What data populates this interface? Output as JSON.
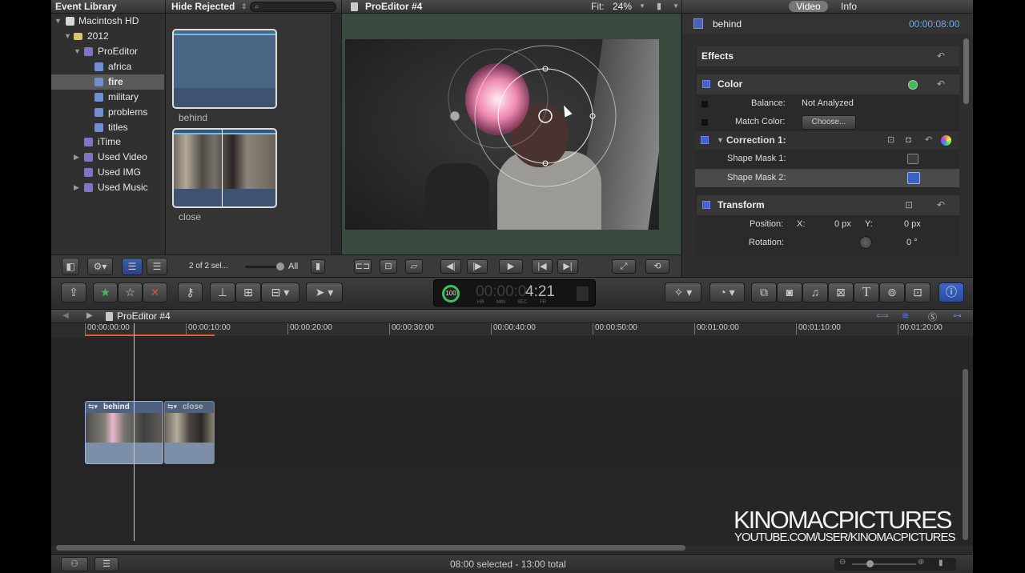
{
  "event_library": {
    "title": "Event Library",
    "items": [
      {
        "label": "Macintosh HD",
        "icon": "hard-drive-icon"
      },
      {
        "label": "2012",
        "icon": "folder-icon"
      },
      {
        "label": "ProEditor",
        "icon": "event-star-icon"
      },
      {
        "label": "africa",
        "icon": "keyword-icon"
      },
      {
        "label": "fire",
        "icon": "keyword-icon"
      },
      {
        "label": "military",
        "icon": "keyword-icon"
      },
      {
        "label": "problems",
        "icon": "keyword-icon"
      },
      {
        "label": "titles",
        "icon": "keyword-icon"
      },
      {
        "label": "iTime",
        "icon": "event-star-icon"
      },
      {
        "label": "Used Video",
        "icon": "event-star-icon"
      },
      {
        "label": "Used IMG",
        "icon": "event-star-icon"
      },
      {
        "label": "Used Music",
        "icon": "event-star-icon"
      }
    ]
  },
  "browser": {
    "filter_label": "Hide Rejected",
    "search_placeholder": "",
    "clips": [
      {
        "label": "behind"
      },
      {
        "label": "close"
      }
    ],
    "selection_info": "2 of 2 sel...",
    "duration_all": "All"
  },
  "viewer": {
    "title": "ProEditor #4",
    "fit_label": "Fit:",
    "zoom": "24%"
  },
  "inspector": {
    "tabs": [
      "Video",
      "Info"
    ],
    "active_tab": "Video",
    "clip_name": "behind",
    "clip_duration": "00:00:08:00",
    "effects_label": "Effects",
    "color_label": "Color",
    "balance_label": "Balance:",
    "balance_value": "Not Analyzed",
    "match_color_label": "Match Color:",
    "choose_label": "Choose...",
    "correction_label": "Correction 1:",
    "shape_mask_1": "Shape Mask 1:",
    "shape_mask_2": "Shape Mask 2:",
    "transform_label": "Transform",
    "position_label": "Position:",
    "x_label": "X:",
    "x_value": "0 px",
    "y_label": "Y:",
    "y_value": "0 px",
    "rotation_label": "Rotation:",
    "rotation_value": "0 °"
  },
  "dashboard": {
    "percent": "100",
    "timecode_dim": "00:00:0",
    "timecode_bright": "4:21",
    "units": [
      "HR",
      "MIN",
      "SEC",
      "FR"
    ]
  },
  "timeline": {
    "project_title": "ProEditor #4",
    "ruler": [
      "00:00:00:00",
      "00:00:10:00",
      "00:00:20:00",
      "00:00:30:00",
      "00:00:40:00",
      "00:00:50:00",
      "00:01:00:00",
      "00:01:10:00",
      "00:01:20:00"
    ],
    "clips": [
      {
        "label": "behind"
      },
      {
        "label": "close"
      }
    ]
  },
  "status": {
    "selection": "08:00 selected - 13:00 total"
  },
  "watermark": {
    "line1": "KINOMACPICTURES",
    "line2": "YOUTUBE.COM/USER/KINOMACPICTURES"
  },
  "colors": {
    "accent_blue": "#4561d4",
    "playhead_orange": "#e0623a",
    "timecode_green": "#3fbf56"
  }
}
